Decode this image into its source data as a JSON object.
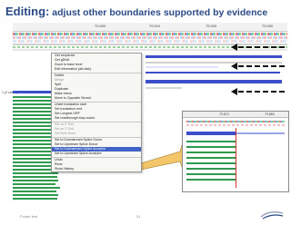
{
  "slide": {
    "title_bold": "Editing:",
    "title_rest": " adjust other boundaries supported by evidence",
    "footer_left": "Footer text",
    "page_number": "31"
  },
  "ruler": {
    "ticks": [
      "79,900",
      "79,910",
      "79,920",
      "79,930"
    ]
  },
  "left_label": "1 (2 cdna )",
  "context_menu": {
    "items": [
      {
        "label": "Get sequence",
        "state": "normal"
      },
      {
        "label": "Get gDNA",
        "state": "normal"
      },
      {
        "label": "Zoom to base level",
        "state": "normal"
      },
      {
        "label": "Edit information (alt-click)",
        "state": "normal"
      },
      {
        "sep": true
      },
      {
        "label": "Delete",
        "state": "normal"
      },
      {
        "label": "Merge",
        "state": "disabled"
      },
      {
        "label": "Split",
        "state": "normal"
      },
      {
        "label": "Duplicate",
        "state": "normal"
      },
      {
        "label": "Make intron",
        "state": "normal"
      },
      {
        "label": "Move to Opposite Strand",
        "state": "normal"
      },
      {
        "sep": true
      },
      {
        "label": "Unset translation start",
        "state": "normal"
      },
      {
        "label": "Set translation end",
        "state": "normal"
      },
      {
        "label": "Set Longest ORF",
        "state": "normal"
      },
      {
        "label": "Set readthrough stop codon",
        "state": "normal"
      },
      {
        "sep": true
      },
      {
        "label": "Set as 5' End",
        "state": "disabled"
      },
      {
        "label": "Set as 3' End",
        "state": "disabled"
      },
      {
        "label": "Set Both Ends",
        "state": "disabled"
      },
      {
        "sep": true
      },
      {
        "label": "Set to Downstream Splice Donor",
        "state": "normal"
      },
      {
        "label": "Set to Upstream Splice Donor",
        "state": "normal"
      },
      {
        "label": "Set to Downstream Splice Acceptor",
        "state": "selected"
      },
      {
        "label": "Set to Upstream Splice Acceptor",
        "state": "normal"
      },
      {
        "sep": true
      },
      {
        "label": "Undo",
        "state": "normal"
      },
      {
        "label": "Redo",
        "state": "normal"
      },
      {
        "label": "Show History",
        "state": "normal"
      }
    ]
  },
  "zoom_panel": {
    "ticks": [
      "79,870",
      "79,880"
    ]
  },
  "colors": {
    "title": "#2a4a86",
    "menu_highlight": "#3f62c4",
    "feature_blue": "#3b4fc8",
    "match_green": "#2e9a4e",
    "arrow_fill": "#f4c66a"
  }
}
